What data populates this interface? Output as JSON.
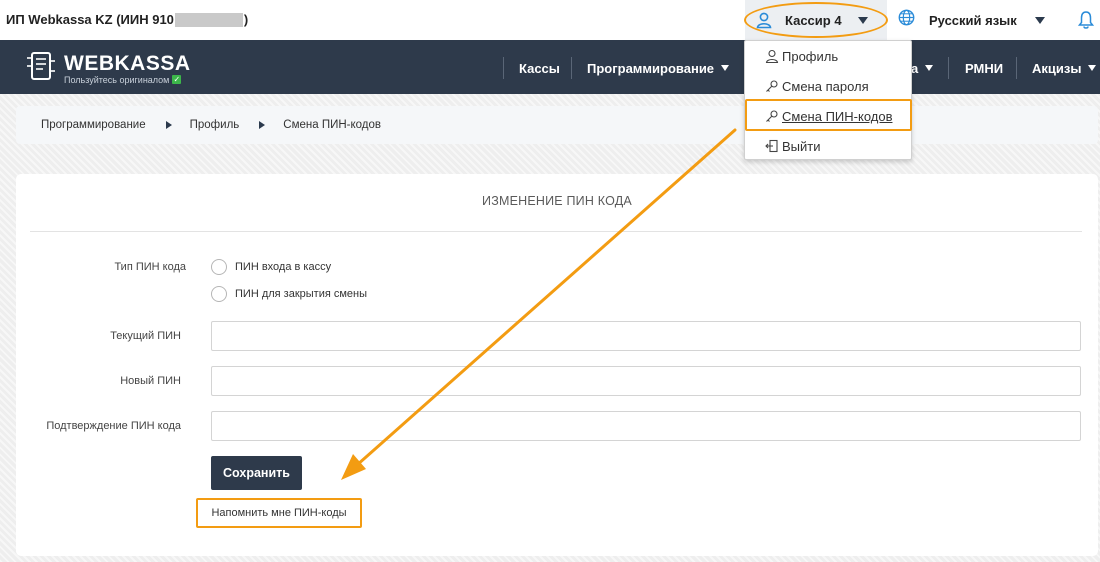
{
  "header": {
    "company_prefix": "ИП Webkassa KZ (ИИН 910",
    "company_suffix": ")",
    "user_name": "Кассир 4",
    "language": "Русский язык"
  },
  "navbar": {
    "logo_title": "WEBKASSA",
    "logo_subtitle": "Пользуйтесь оригиналом",
    "items": [
      {
        "label": "Кассы"
      },
      {
        "label": "Программирование"
      },
      {
        "label": "а"
      },
      {
        "label": "РМНИ"
      },
      {
        "label": "Акцизы"
      }
    ]
  },
  "breadcrumb": {
    "items": [
      "Программирование",
      "Профиль",
      "Смена ПИН-кодов"
    ]
  },
  "form": {
    "title": "ИЗМЕНЕНИЕ ПИН КОДА",
    "pin_type_label": "Тип ПИН кода",
    "radio_options": [
      "ПИН входа в кассу",
      "ПИН для закрытия смены"
    ],
    "current_pin_label": "Текущий ПИН",
    "new_pin_label": "Новый ПИН",
    "confirm_pin_label": "Подтверждение ПИН кода",
    "current_pin_value": "",
    "new_pin_value": "",
    "confirm_pin_value": "",
    "save_label": "Сохранить",
    "remind_label": "Напомнить мне ПИН-коды"
  },
  "user_dropdown": {
    "items": [
      {
        "label": "Профиль",
        "icon": "user-icon"
      },
      {
        "label": "Смена пароля",
        "icon": "key-icon"
      },
      {
        "label": "Смена ПИН-кодов",
        "icon": "key-icon"
      },
      {
        "label": "Выйти",
        "icon": "logout-icon"
      }
    ]
  },
  "colors": {
    "navbar": "#2e3a4b",
    "highlight": "#f39c12",
    "accent_blue": "#2a8bd8",
    "verified_green": "#3cb64a"
  }
}
